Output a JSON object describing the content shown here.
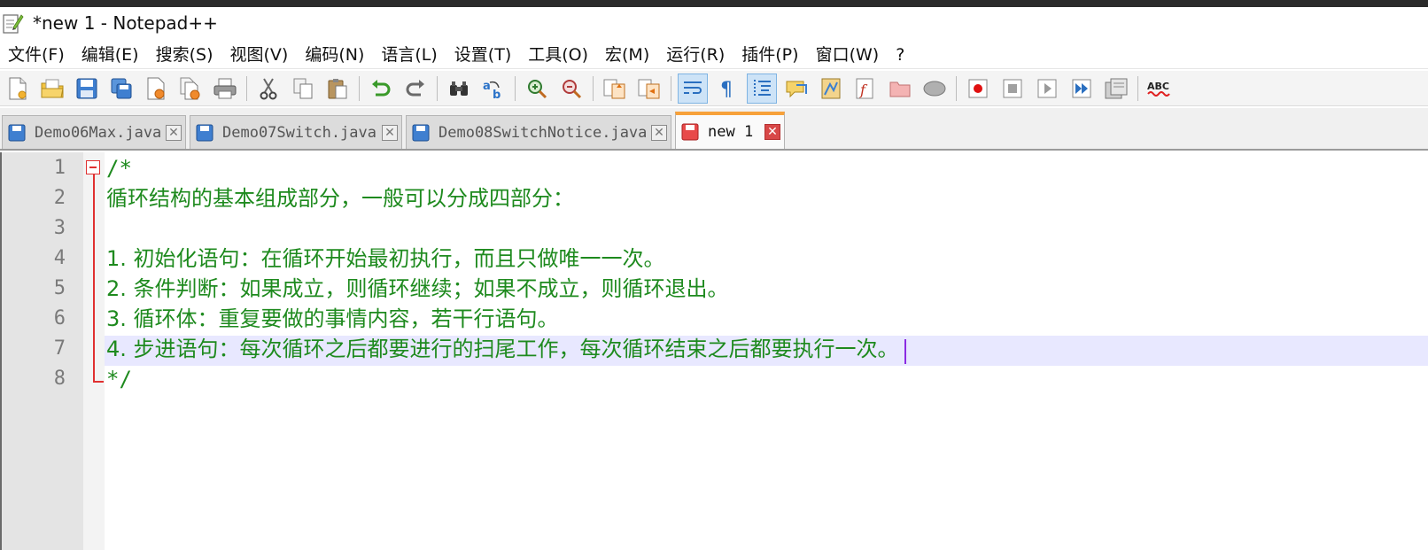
{
  "window": {
    "title": "*new 1 - Notepad++"
  },
  "menu": [
    "文件(F)",
    "编辑(E)",
    "搜索(S)",
    "视图(V)",
    "编码(N)",
    "语言(L)",
    "设置(T)",
    "工具(O)",
    "宏(M)",
    "运行(R)",
    "插件(P)",
    "窗口(W)",
    "?"
  ],
  "toolbar": {
    "icons": [
      "new-file-icon",
      "open-file-icon",
      "save-icon",
      "save-all-icon",
      "close-icon",
      "close-all-icon",
      "print-icon",
      "cut-icon",
      "copy-icon",
      "paste-icon",
      "undo-icon",
      "redo-icon",
      "find-icon",
      "replace-icon",
      "zoom-in-icon",
      "zoom-out-icon",
      "sync-vertical-icon",
      "sync-horizontal-icon",
      "word-wrap-icon",
      "show-all-characters-icon",
      "indent-guide-icon",
      "user-language-icon",
      "document-map-icon",
      "function-list-icon",
      "folder-workspace-icon",
      "monitoring-icon",
      "record-macro-icon",
      "stop-recording-icon",
      "play-macro-icon",
      "run-macro-multiple-icon",
      "save-macro-icon",
      "spell-check-icon"
    ],
    "spell_check_label": "ABC"
  },
  "tabs": [
    {
      "label": "Demo06Max.java",
      "icon": "saved-file-icon",
      "active": false
    },
    {
      "label": "Demo07Switch.java",
      "icon": "saved-file-icon",
      "active": false
    },
    {
      "label": "Demo08SwitchNotice.java",
      "icon": "saved-file-icon",
      "active": false
    },
    {
      "label": "new 1",
      "icon": "unsaved-file-icon",
      "active": true
    }
  ],
  "tab_close_glyph": "✕",
  "editor": {
    "line_numbers": [
      "1",
      "2",
      "3",
      "4",
      "5",
      "6",
      "7",
      "8"
    ],
    "lines": [
      "/*",
      "循环结构的基本组成部分，一般可以分成四部分：",
      "",
      "1. 初始化语句：在循环开始最初执行，而且只做唯一一次。",
      "2. 条件判断：如果成立，则循环继续；如果不成立，则循环退出。",
      "3. 循环体：重复要做的事情内容，若干行语句。",
      "4. 步进语句：每次循环之后都要进行的扫尾工作，每次循环结束之后都要执行一次。",
      "*/"
    ],
    "current_line": 7,
    "comment_color": "#1e8a1e"
  },
  "colors": {
    "fold_marker": "#e03030",
    "current_line_bg": "#e8e8ff",
    "active_tab_accent": "#f7a13a",
    "caret": "#8a2be2"
  }
}
